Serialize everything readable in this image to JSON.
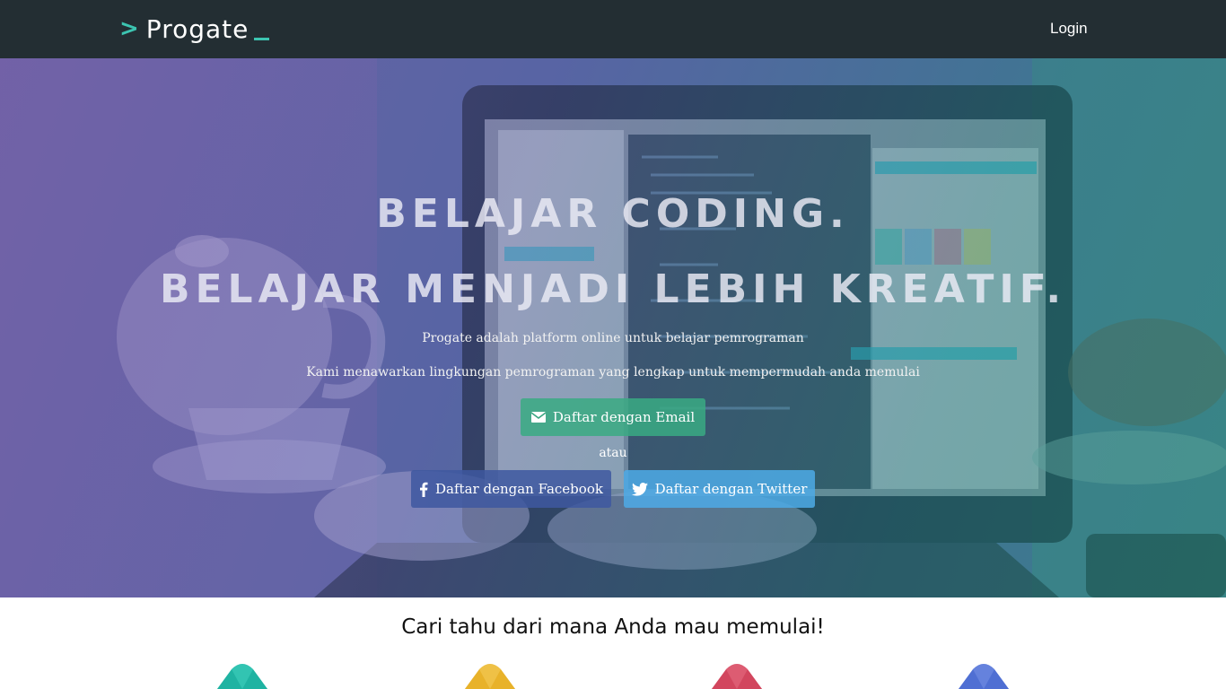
{
  "header": {
    "logo_chevron": ">",
    "logo_text": "Progate",
    "login_label": "Login"
  },
  "hero": {
    "headline_1": "BELAJAR CODING.",
    "headline_2": "BELAJAR MENJADI LEBIH KREATIF.",
    "subline_1": "Progate adalah platform online untuk belajar pemrograman",
    "subline_2": "Kami menawarkan lingkungan pemrograman yang lengkap untuk mempermudah anda memulai",
    "email_button": "Daftar dengan Email",
    "or_text": "atau",
    "facebook_button": "Daftar dengan Facebook",
    "twitter_button": "Daftar dengan Twitter"
  },
  "section": {
    "title": "Cari tahu dari mana Anda mau memulai!"
  },
  "colors": {
    "topbar": "#232e33",
    "brand_accent": "#3cc4b1",
    "tile_1": "#1fb3a2",
    "tile_2": "#e8b22a",
    "tile_3": "#d2465e",
    "tile_4": "#4f6fd3"
  }
}
